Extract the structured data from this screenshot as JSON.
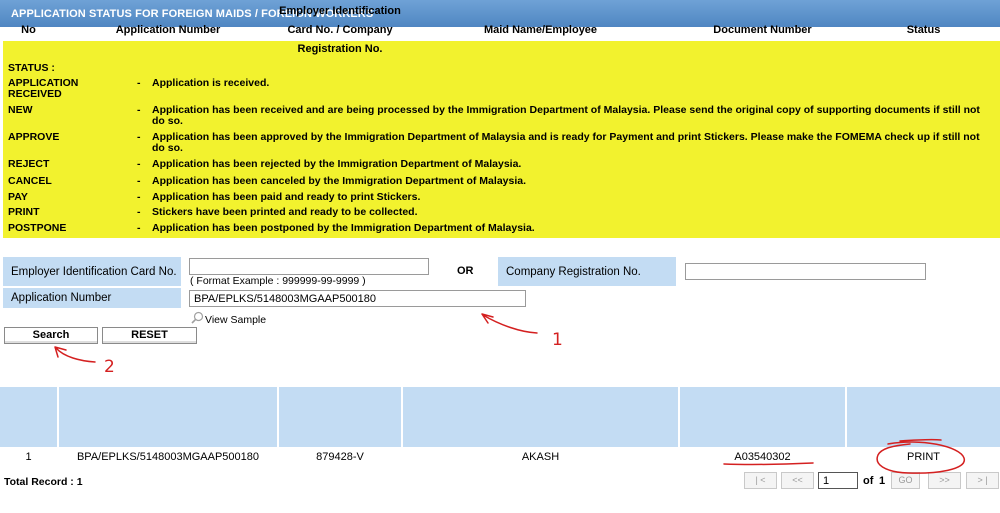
{
  "page_title": "APPLICATION STATUS FOR FOREIGN MAIDS / FOREIGN WORKERS",
  "status_legend": {
    "heading": "STATUS :",
    "separator": "-",
    "items": [
      {
        "code": "APPLICATION RECEIVED",
        "description": "Application is received."
      },
      {
        "code": "NEW",
        "description": "Application has been received and are being processed by the Immigration Department of Malaysia. Please send the original copy of supporting documents if still not do so."
      },
      {
        "code": "APPROVE",
        "description": "Application has been approved by the Immigration Department of Malaysia and is ready for Payment and print Stickers. Please make the FOMEMA check up if still not do so."
      },
      {
        "code": "REJECT",
        "description": "Application has been rejected by the Immigration Department of Malaysia."
      },
      {
        "code": "CANCEL",
        "description": "Application has been canceled by the Immigration Department of Malaysia."
      },
      {
        "code": "PAY",
        "description": "Application has been paid and ready to print Stickers."
      },
      {
        "code": "PRINT",
        "description": "Stickers have been printed and ready to be collected."
      },
      {
        "code": "POSTPONE",
        "description": "Application has been postponed by the Immigration Department of Malaysia."
      }
    ]
  },
  "search_form": {
    "employer_ic_label": "Employer Identification Card No.",
    "employer_ic_value": "",
    "employer_ic_hint": "( Format Example : 999999-99-9999 )",
    "or_label": "OR",
    "company_reg_label": "Company Registration No.",
    "company_reg_value": "",
    "application_number_label": "Application Number",
    "application_number_value": "BPA/EPLKS/5148003MGAAP500180",
    "view_sample_label": "View Sample",
    "search_button": "Search",
    "reset_button": "RESET"
  },
  "results_table": {
    "columns": [
      "No",
      "Application Number",
      "Employer Identification Card No. / Company Registration No.",
      "Maid Name/Employee",
      "Document Number",
      "Status"
    ],
    "rows": [
      {
        "no": "1",
        "application_number": "BPA/EPLKS/5148003MGAAP500180",
        "employer_id": "879428-V",
        "maid_name": "AKASH",
        "document_number": "A03540302",
        "status": "PRINT"
      }
    ]
  },
  "footer": {
    "total_record": "Total Record : 1"
  },
  "pagination": {
    "first": "| <",
    "prev": "<<",
    "current_page": "1",
    "of_label": "of",
    "total_pages": "1",
    "go": "GO",
    "next": ">>",
    "last": "> |"
  },
  "annotations": {
    "label_1": "1",
    "label_2": "2",
    "ink_color": "#d42020"
  },
  "colors": {
    "title_bar": "#5b90c9",
    "status_box": "#f2f22e",
    "label_bg": "#c3dcf3"
  }
}
